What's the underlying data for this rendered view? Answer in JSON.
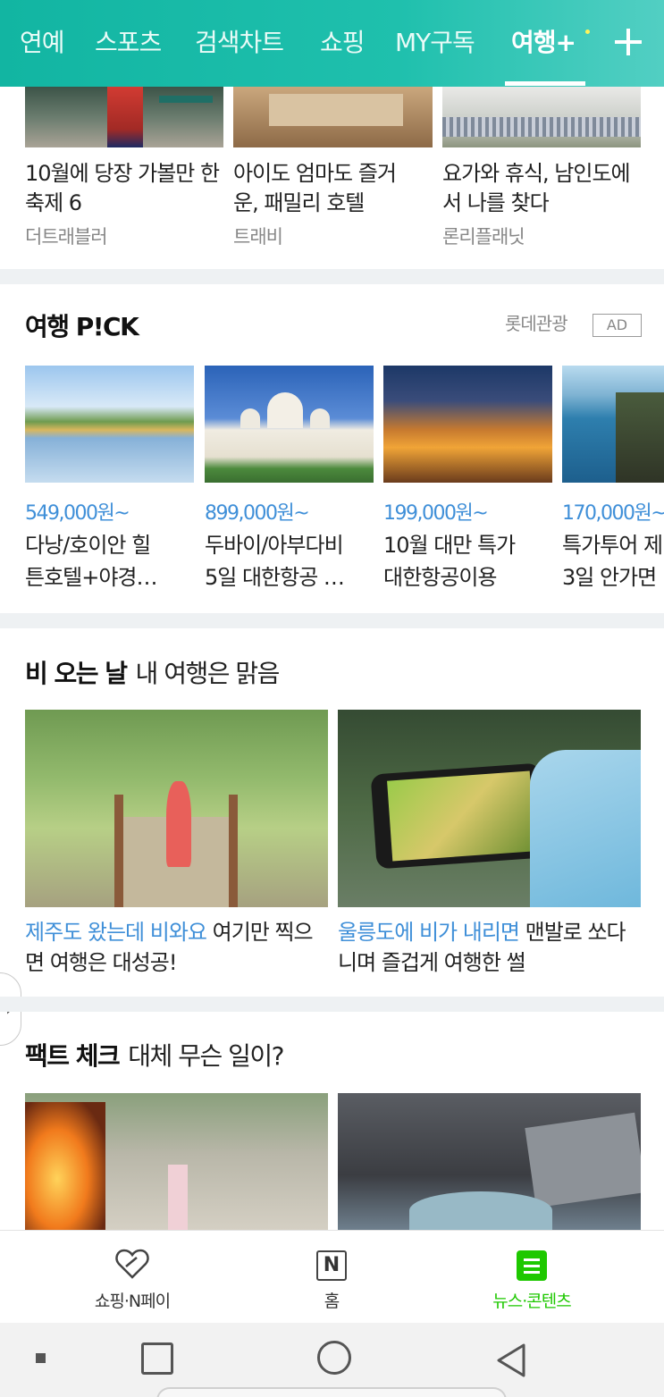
{
  "topbar": {
    "tabs": [
      {
        "label": "연예"
      },
      {
        "label": "스포츠"
      },
      {
        "label": "검색차트"
      },
      {
        "label": "쇼핑"
      },
      {
        "label": "MY구독"
      },
      {
        "label": "여행+"
      }
    ],
    "active_tab": "여행+",
    "add_icon": "plus-icon",
    "accent_color": "#1fbfa9"
  },
  "top_articles": [
    {
      "title": "10월에 당장 가볼만 한 축제 6",
      "source": "더트래블러"
    },
    {
      "title": "아이도 엄마도 즐거운, 패밀리 호텔",
      "source": "트래비"
    },
    {
      "title": "요가와 휴식, 남인도에서 나를 찾다",
      "source": "론리플래닛"
    }
  ],
  "pick": {
    "title": "여행 P!CK",
    "sponsor": "롯데관광",
    "ad_badge": "AD",
    "items": [
      {
        "price": "549,000원~",
        "title_line1": "다낭/호이안 힐",
        "title_line2": "튼호텔+야경…"
      },
      {
        "price": "899,000원~",
        "title_line1": "두바이/아부다비",
        "title_line2": "5일 대한항공 …"
      },
      {
        "price": "199,000원~",
        "title_line1": "10월 대만 특가",
        "title_line2": "대한항공이용"
      },
      {
        "price": "170,000원~",
        "title_line1": "특가투어 제",
        "title_line2": "3일 안가면"
      }
    ]
  },
  "rain": {
    "title": "비 오는 날",
    "subtitle": "내 여행은 맑음",
    "stories": [
      {
        "highlight": "제주도 왔는데 비와요",
        "rest": " 여기만 찍으면 여행은 대성공!"
      },
      {
        "highlight": "울릉도에 비가 내리면",
        "rest": " 맨발로 쏘다니며 즐겁게 여행한 썰"
      }
    ]
  },
  "fact": {
    "title": "팩트 체크",
    "subtitle": "대체 무슨 일이?"
  },
  "bottom_nav": {
    "items": [
      {
        "label": "쇼핑·N페이",
        "icon": "heart-tag-icon"
      },
      {
        "label": "홈",
        "icon": "n-logo-icon",
        "glyph": "N"
      },
      {
        "label": "뉴스·콘텐츠",
        "icon": "news-list-icon"
      }
    ],
    "active_color": "#1ec800"
  },
  "system_bar": {
    "buttons": [
      "menu-dot",
      "recent-apps",
      "home",
      "back"
    ]
  }
}
